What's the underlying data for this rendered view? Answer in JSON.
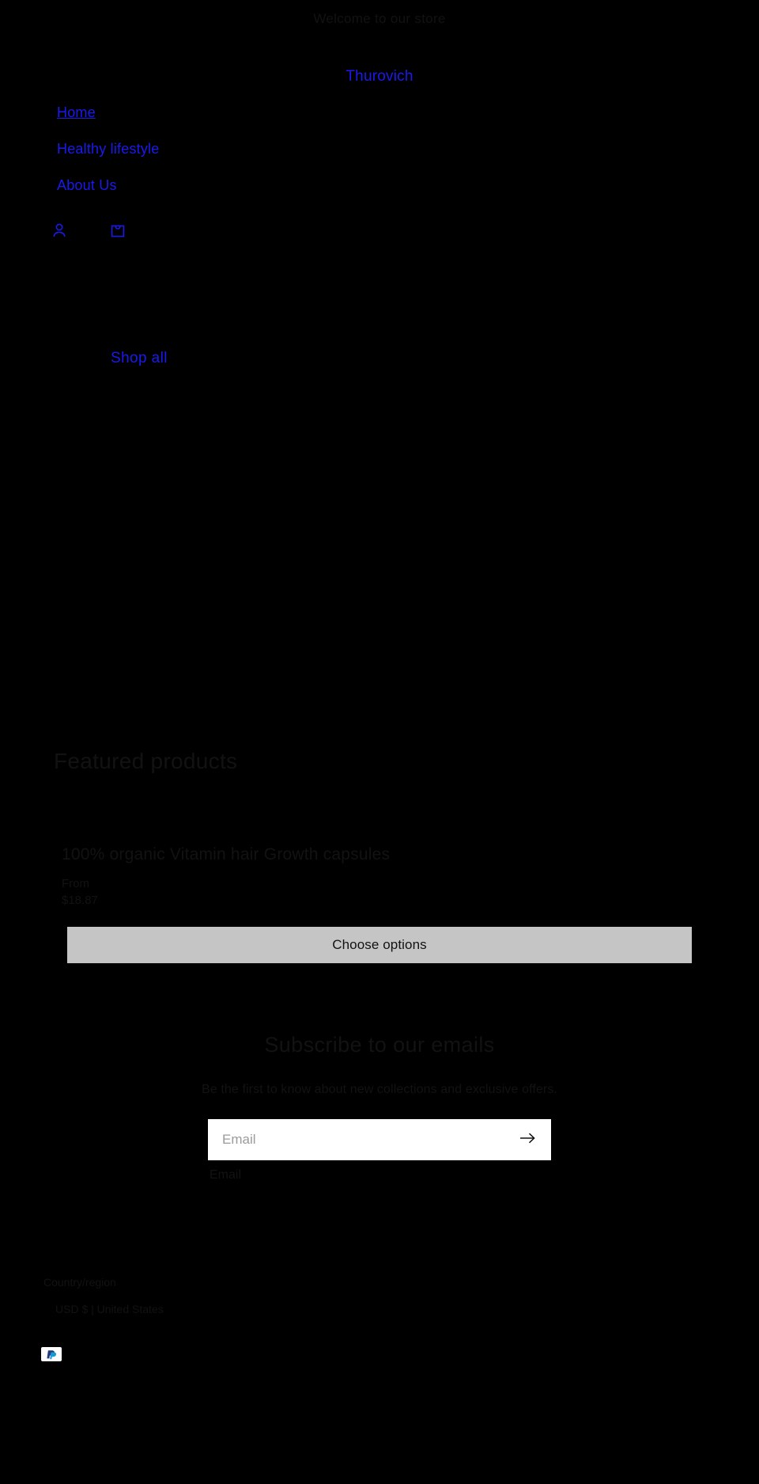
{
  "announcement": {
    "text": "Welcome to our store"
  },
  "header": {
    "brand": "Thurovich",
    "nav": [
      {
        "label": "Home"
      },
      {
        "label": "Healthy lifestyle"
      },
      {
        "label": "About Us"
      }
    ],
    "icons": {
      "account": "account-person-icon",
      "cart": "shopping-bag-icon"
    }
  },
  "hero": {
    "heading": "",
    "text": "",
    "cta_label": "Shop all"
  },
  "featured": {
    "title": "Featured products",
    "products": [
      {
        "title": "100% organic Vitamin hair Growth capsules",
        "price_prefix": "From",
        "price": "$18.87",
        "button_label": "Choose options"
      }
    ]
  },
  "newsletter": {
    "title": "Subscribe to our emails",
    "subtitle": "Be the first to know about new collections and exclusive offers.",
    "placeholder": "Email",
    "label": "Email",
    "submit_icon": "arrow-right-icon"
  },
  "footer": {
    "localization_title": "Country/region",
    "country_selected": "USD $ | United States",
    "payment_methods": [
      {
        "name": "paypal-icon"
      }
    ]
  },
  "colors": {
    "background": "#000000",
    "link": "#1a1aee",
    "dark_text": "#121212",
    "button_bg": "#c5c5c5",
    "field_bg": "#ffffff"
  }
}
